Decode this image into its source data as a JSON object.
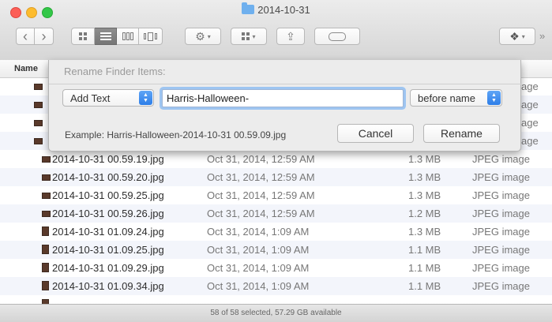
{
  "window": {
    "title": "2014-10-31",
    "status": "58 of 58 selected, 57.29 GB available",
    "overflow_glyph": "»"
  },
  "toolbar": {
    "back_glyph": "‹",
    "forward_glyph": "›",
    "action_glyph": "⚙",
    "share_glyph": "⇪",
    "dropbox_glyph": "❖",
    "caret": "▾"
  },
  "list": {
    "name_header": "Name",
    "behind_kind": [
      "age",
      "age",
      "age",
      "age"
    ],
    "rows": [
      {
        "name": "2014-10-31 00.59.19.jpg",
        "date": "Oct 31, 2014, 12:59 AM",
        "size": "1.3 MB",
        "kind": "JPEG image",
        "thumb": "wide"
      },
      {
        "name": "2014-10-31 00.59.20.jpg",
        "date": "Oct 31, 2014, 12:59 AM",
        "size": "1.3 MB",
        "kind": "JPEG image",
        "thumb": "wide"
      },
      {
        "name": "2014-10-31 00.59.25.jpg",
        "date": "Oct 31, 2014, 12:59 AM",
        "size": "1.3 MB",
        "kind": "JPEG image",
        "thumb": "wide"
      },
      {
        "name": "2014-10-31 00.59.26.jpg",
        "date": "Oct 31, 2014, 12:59 AM",
        "size": "1.2 MB",
        "kind": "JPEG image",
        "thumb": "wide"
      },
      {
        "name": "2014-10-31 01.09.24.jpg",
        "date": "Oct 31, 2014, 1:09 AM",
        "size": "1.3 MB",
        "kind": "JPEG image",
        "thumb": "tall"
      },
      {
        "name": "2014-10-31 01.09.25.jpg",
        "date": "Oct 31, 2014, 1:09 AM",
        "size": "1.1 MB",
        "kind": "JPEG image",
        "thumb": "tall"
      },
      {
        "name": "2014-10-31 01.09.29.jpg",
        "date": "Oct 31, 2014, 1:09 AM",
        "size": "1.1 MB",
        "kind": "JPEG image",
        "thumb": "tall"
      },
      {
        "name": "2014-10-31 01.09.34.jpg",
        "date": "Oct 31, 2014, 1:09 AM",
        "size": "1.1 MB",
        "kind": "JPEG image",
        "thumb": "tall"
      }
    ]
  },
  "rename_sheet": {
    "title": "Rename Finder Items:",
    "mode": "Add Text",
    "text_value": "Harris-Halloween-",
    "position": "before name",
    "example": "Example: Harris-Halloween-2014-10-31 00.59.09.jpg",
    "cancel_label": "Cancel",
    "rename_label": "Rename",
    "popup_up": "▲",
    "popup_down": "▼"
  },
  "colors": {
    "accent": "#2d7ee8",
    "focus_ring": "#5fa5f6",
    "close": "#fc5f57",
    "minimize": "#fdbc2e",
    "zoom": "#33c748"
  }
}
